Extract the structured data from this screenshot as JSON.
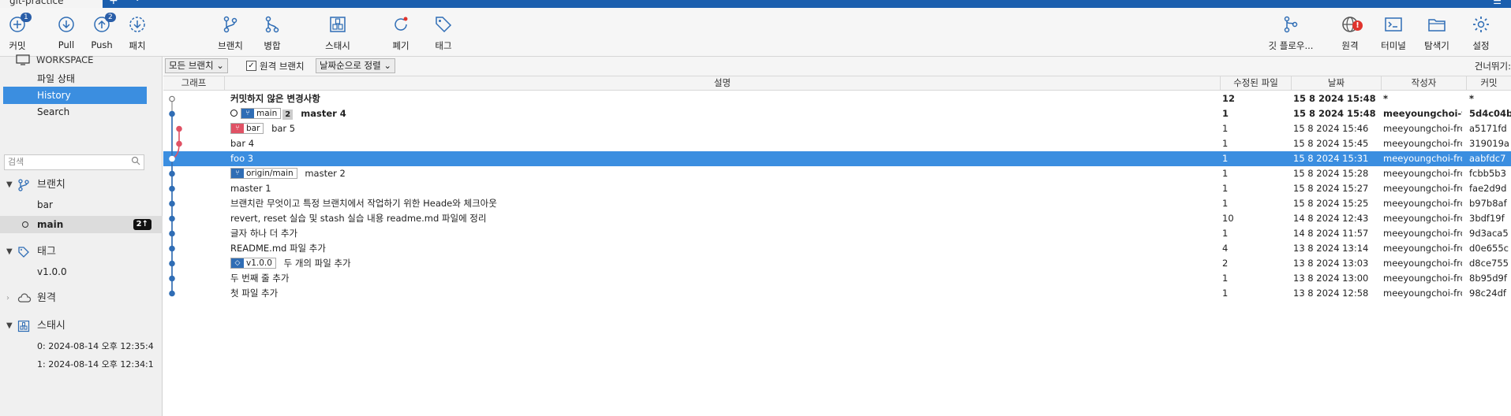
{
  "window": {
    "tab_title": "git-practice",
    "tab_add": "+",
    "tab_menu": "⌄",
    "win_btn": "☰"
  },
  "toolbar": {
    "left": [
      {
        "label": "커밋",
        "icon": "add-circle-icon",
        "badge": "1"
      },
      {
        "label": "Pull",
        "icon": "pull-arrow-icon",
        "badge": ""
      },
      {
        "label": "Push",
        "icon": "push-arrow-icon",
        "badge": "2"
      },
      {
        "label": "패치",
        "icon": "fetch-icon",
        "badge": ""
      },
      {
        "label": "브랜치",
        "icon": "branch-icon",
        "badge": ""
      },
      {
        "label": "병합",
        "icon": "merge-icon",
        "badge": ""
      },
      {
        "label": "스태시",
        "icon": "stash-icon",
        "badge": ""
      },
      {
        "label": "폐기",
        "icon": "discard-icon",
        "badge": ""
      },
      {
        "label": "태그",
        "icon": "tag-icon",
        "badge": ""
      }
    ],
    "right": [
      {
        "label": "깃 플로우...",
        "icon": "git-flow-icon"
      },
      {
        "label": "원격",
        "icon": "remote-globe-icon",
        "alert": "!"
      },
      {
        "label": "터미널",
        "icon": "terminal-icon"
      },
      {
        "label": "탐색기",
        "icon": "explorer-folder-icon"
      },
      {
        "label": "설정",
        "icon": "settings-gear-icon"
      }
    ]
  },
  "sidebar": {
    "workspace_label": "WORKSPACE",
    "workspace_items": [
      "파일 상태",
      "History",
      "Search"
    ],
    "selected_item": "History",
    "search_placeholder": "검색",
    "branches_label": "브랜치",
    "branches": [
      {
        "name": "bar",
        "current": false,
        "count": ""
      },
      {
        "name": "main",
        "current": true,
        "count": "2↑"
      }
    ],
    "tags_label": "태그",
    "tags": [
      "v1.0.0"
    ],
    "remotes_label": "원격",
    "stashes_label": "스태시",
    "stashes": [
      "0: 2024-08-14 오후 12:35:4",
      "1: 2024-08-14 오후 12:34:1"
    ]
  },
  "filter": {
    "branch_filter": "모든 브랜치",
    "remote_checkbox_label": "원격 브랜치",
    "remote_checked": true,
    "sort_filter": "날짜순으로 정렬",
    "skip_label": "건너뛰기:"
  },
  "columns": {
    "graph": "그래프",
    "description": "설명",
    "files": "수정된 파일",
    "date": "날짜",
    "author": "작성자",
    "commit": "커밋"
  },
  "commits": [
    {
      "desc": "커밋하지 않은 변경사항",
      "files": "12",
      "date": "15 8 2024 15:48",
      "author": "*",
      "commit": "*",
      "bold": true,
      "selected": false,
      "refs": [],
      "head": false
    },
    {
      "desc": "master 4",
      "files": "1",
      "date": "15 8 2024 15:48",
      "author": "meeyoungchoi-fr",
      "commit": "5d4c04b",
      "bold": true,
      "selected": false,
      "refs": [
        {
          "name": "main",
          "kind": "local-main",
          "extra": "2"
        }
      ],
      "head": true
    },
    {
      "desc": "bar 5",
      "files": "1",
      "date": "15 8 2024 15:46",
      "author": "meeyoungchoi-frc",
      "commit": "a5171fd",
      "bold": false,
      "selected": false,
      "refs": [
        {
          "name": "bar",
          "kind": "local-bar",
          "extra": ""
        }
      ],
      "head": false
    },
    {
      "desc": "bar 4",
      "files": "1",
      "date": "15 8 2024 15:45",
      "author": "meeyoungchoi-frc",
      "commit": "319019a",
      "bold": false,
      "selected": false,
      "refs": [],
      "head": false
    },
    {
      "desc": "foo 3",
      "files": "1",
      "date": "15 8 2024 15:31",
      "author": "meeyoungchoi-frc",
      "commit": "aabfdc7",
      "bold": false,
      "selected": true,
      "refs": [],
      "head": false
    },
    {
      "desc": "master 2",
      "files": "1",
      "date": "15 8 2024 15:28",
      "author": "meeyoungchoi-frc",
      "commit": "fcbb5b3",
      "bold": false,
      "selected": false,
      "refs": [
        {
          "name": "origin/main",
          "kind": "remote",
          "extra": ""
        }
      ],
      "head": false
    },
    {
      "desc": "master 1",
      "files": "1",
      "date": "15 8 2024 15:27",
      "author": "meeyoungchoi-frc",
      "commit": "fae2d9d",
      "bold": false,
      "selected": false,
      "refs": [],
      "head": false
    },
    {
      "desc": "브랜치란 무엇이고 특정 브랜치에서 작업하기 위한 Heade와 체크아웃",
      "files": "1",
      "date": "15 8 2024 15:25",
      "author": "meeyoungchoi-frc",
      "commit": "b97b8af",
      "bold": false,
      "selected": false,
      "refs": [],
      "head": false
    },
    {
      "desc": "revert, reset 실습 및 stash 실습 내용 readme.md 파일에 정리",
      "files": "10",
      "date": "14 8 2024 12:43",
      "author": "meeyoungchoi-frc",
      "commit": "3bdf19f",
      "bold": false,
      "selected": false,
      "refs": [],
      "head": false
    },
    {
      "desc": "글자 하나 더 추가",
      "files": "1",
      "date": "14 8 2024 11:57",
      "author": "meeyoungchoi-frc",
      "commit": "9d3aca5",
      "bold": false,
      "selected": false,
      "refs": [],
      "head": false
    },
    {
      "desc": "README.md 파일 추가",
      "files": "4",
      "date": "13 8 2024 13:14",
      "author": "meeyoungchoi-frc",
      "commit": "d0e655c",
      "bold": false,
      "selected": false,
      "refs": [],
      "head": false
    },
    {
      "desc": "두 개의 파일 추가",
      "files": "2",
      "date": "13 8 2024 13:03",
      "author": "meeyoungchoi-frc",
      "commit": "d8ce755",
      "bold": false,
      "selected": false,
      "refs": [
        {
          "name": "v1.0.0",
          "kind": "tag",
          "extra": ""
        }
      ],
      "head": false
    },
    {
      "desc": "두 번째 줄 추가",
      "files": "1",
      "date": "13 8 2024 13:00",
      "author": "meeyoungchoi-frc",
      "commit": "8b95d9f",
      "bold": false,
      "selected": false,
      "refs": [],
      "head": false
    },
    {
      "desc": "첫 파일 추가",
      "files": "1",
      "date": "13 8 2024 12:58",
      "author": "meeyoungchoi-frc",
      "commit": "98c24df",
      "bold": false,
      "selected": false,
      "refs": [],
      "head": false
    }
  ],
  "colors": {
    "titlebar": "#1b5fae",
    "selection": "#3b8ee0",
    "graph_main": "#2f6db5",
    "graph_bar": "#e05265"
  }
}
